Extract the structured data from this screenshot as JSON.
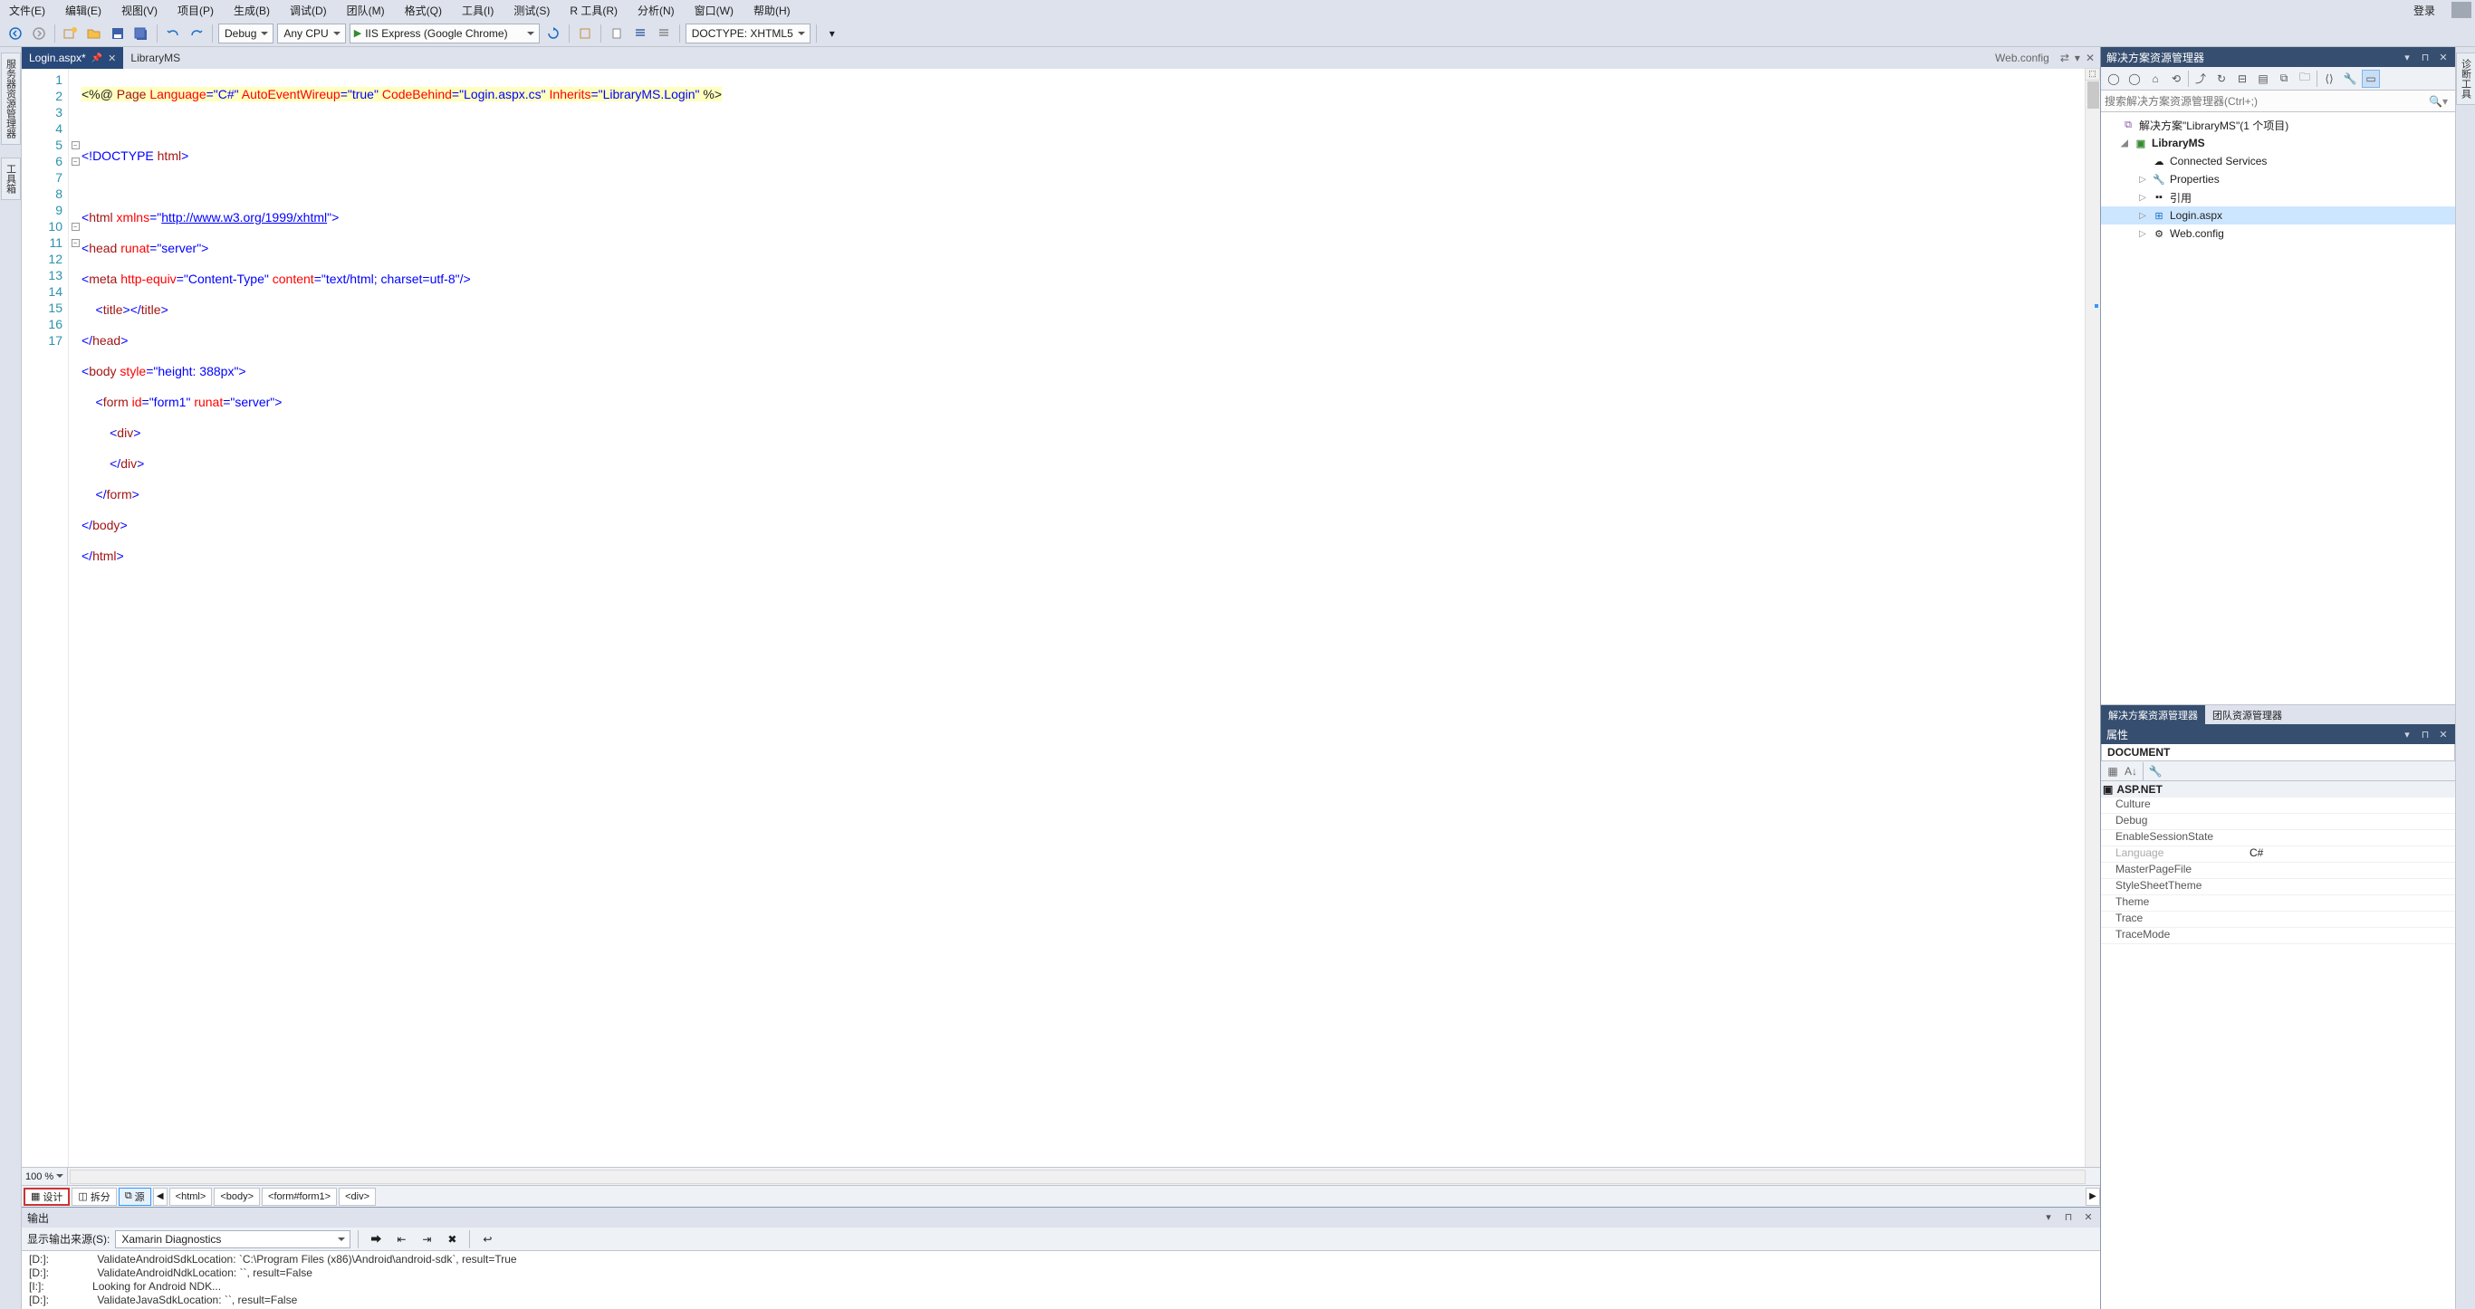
{
  "menu": {
    "items": [
      "文件(E)",
      "编辑(E)",
      "视图(V)",
      "项目(P)",
      "生成(B)",
      "调试(D)",
      "团队(M)",
      "格式(Q)",
      "工具(I)",
      "测试(S)",
      "R 工具(R)",
      "分析(N)",
      "窗口(W)",
      "帮助(H)"
    ],
    "login": "登录"
  },
  "toolbar": {
    "config": "Debug",
    "platform": "Any CPU",
    "run": "IIS Express (Google Chrome)",
    "doctype": "DOCTYPE: XHTML5"
  },
  "leftrail": {
    "tab0": "服务器资源管理器",
    "tab1": "工具箱"
  },
  "rightrail": {
    "tab0": "诊断工具"
  },
  "doctabs": {
    "t0": "Login.aspx*",
    "t1": "LibraryMS",
    "trail": "Web.config"
  },
  "code": {
    "l1_a": "<%@",
    "l1_b": " Page ",
    "l1_c": "Language",
    "l1_d": "=\"C#\"",
    "l1_e": " AutoEventWireup",
    "l1_f": "=\"true\"",
    "l1_g": " CodeBehind",
    "l1_h": "=\"Login.aspx.cs\"",
    "l1_i": " Inherits",
    "l1_j": "=\"LibraryMS.Login\"",
    "l1_k": " %>",
    "l3": "<!DOCTYPE",
    "l3b": " html",
    "l3c": ">",
    "l5a": "<",
    "l5b": "html",
    "l5c": " xmlns",
    "l5d": "=\"",
    "l5e": "http://www.w3.org/1999/xhtml",
    "l5f": "\">",
    "l6a": "<",
    "l6b": "head",
    "l6c": " runat",
    "l6d": "=\"server\"",
    "l6e": ">",
    "l7a": "<",
    "l7b": "meta",
    "l7c": " http-equiv",
    "l7d": "=\"Content-Type\"",
    "l7e": " content",
    "l7f": "=\"text/html; charset=utf-8\"",
    "l7g": "/>",
    "l8a": "    <",
    "l8b": "title",
    "l8c": "></",
    "l8d": "title",
    "l8e": ">",
    "l9a": "</",
    "l9b": "head",
    "l9c": ">",
    "l10a": "<",
    "l10b": "body",
    "l10c": " style",
    "l10d": "=\"height: 388px\"",
    "l10e": ">",
    "l11a": "    <",
    "l11b": "form",
    "l11c": " id",
    "l11d": "=\"form1\"",
    "l11e": " runat",
    "l11f": "=\"server\"",
    "l11g": ">",
    "l12a": "        <",
    "l12b": "div",
    "l12c": ">",
    "l13a": "        </",
    "l13b": "div",
    "l13c": ">",
    "l14a": "    </",
    "l14b": "form",
    "l14c": ">",
    "l15a": "</",
    "l15b": "body",
    "l15c": ">",
    "l16a": "</",
    "l16b": "html",
    "l16c": ">"
  },
  "linenums": [
    "1",
    "2",
    "3",
    "4",
    "5",
    "6",
    "7",
    "8",
    "9",
    "10",
    "11",
    "12",
    "13",
    "14",
    "15",
    "16",
    "17"
  ],
  "zoom": "100 %",
  "views": {
    "design": "设计",
    "split": "拆分",
    "source": "源"
  },
  "crumbs": [
    "<html>",
    "<body>",
    "<form#form1>",
    "<div>"
  ],
  "output": {
    "title": "输出",
    "srclabel": "显示输出来源(S):",
    "srcsel": "Xamarin Diagnostics",
    "rows": [
      "[D:]:                ValidateAndroidSdkLocation: `C:\\Program Files (x86)\\Android\\android-sdk`, result=True",
      "[D:]:                ValidateAndroidNdkLocation: ``, result=False",
      "[I:]:                Looking for Android NDK...",
      "[D:]:                ValidateJavaSdkLocation: ``, result=False"
    ]
  },
  "se": {
    "title": "解决方案资源管理器",
    "search_ph": "搜索解决方案资源管理器(Ctrl+;)",
    "sln": "解决方案\"LibraryMS\"(1 个项目)",
    "proj": "LibraryMS",
    "nodes": {
      "cs": "Connected Services",
      "props": "Properties",
      "refs": "引用",
      "login": "Login.aspx",
      "web": "Web.config"
    },
    "tab_se": "解决方案资源管理器",
    "tab_team": "团队资源管理器"
  },
  "props": {
    "title": "属性",
    "doc": "DOCUMENT",
    "cat": "ASP.NET",
    "rows": [
      {
        "n": "Culture",
        "v": ""
      },
      {
        "n": "Debug",
        "v": ""
      },
      {
        "n": "EnableSessionState",
        "v": ""
      },
      {
        "n": "Language",
        "v": "C#",
        "dim": true
      },
      {
        "n": "MasterPageFile",
        "v": ""
      },
      {
        "n": "StyleSheetTheme",
        "v": ""
      },
      {
        "n": "Theme",
        "v": ""
      },
      {
        "n": "Trace",
        "v": ""
      },
      {
        "n": "TraceMode",
        "v": ""
      }
    ]
  }
}
